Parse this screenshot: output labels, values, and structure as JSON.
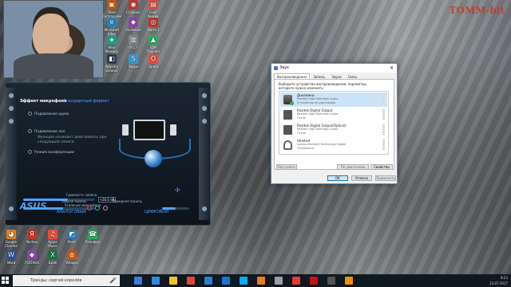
{
  "watermark": "TOMM-bit",
  "desktop_icons": [
    {
      "label": "Total Commander",
      "color": "#d35400",
      "glyph": "▣"
    },
    {
      "label": "CCleaner",
      "color": "#c0392b",
      "glyph": "◉"
    },
    {
      "label": "Foxit Reader",
      "color": "#e74c3c",
      "glyph": "▤"
    },
    {
      "label": "Microsoft Edge",
      "color": "#2980b9",
      "glyph": "e"
    },
    {
      "label": "Uncleaner",
      "color": "#8e44ad",
      "glyph": "◆"
    },
    {
      "label": "Alarm 1",
      "color": "#c0392b",
      "glyph": "◎"
    },
    {
      "label": "Wise Memory",
      "color": "#16a085",
      "glyph": "◈"
    },
    {
      "label": "OCCT",
      "color": "#7f8c8d",
      "glyph": "▥"
    },
    {
      "label": "IDM Thunder",
      "color": "#27ae60",
      "glyph": "▲"
    },
    {
      "label": "Registry Cleaner",
      "color": "#2c3e50",
      "glyph": "◧"
    },
    {
      "label": "Skype",
      "color": "#3498db",
      "glyph": "S"
    },
    {
      "label": "Opera",
      "color": "#e74c3c",
      "glyph": "O"
    }
  ],
  "bottom_icons": [
    {
      "label": "Google Chrome",
      "color": "#e67e22",
      "glyph": "◕"
    },
    {
      "label": "Yandex",
      "color": "#c0392b",
      "glyph": "Я"
    },
    {
      "label": "Apple Music",
      "color": "#e74c3c",
      "glyph": "♫"
    },
    {
      "label": "Paint",
      "color": "#2980b9",
      "glyph": "◩"
    },
    {
      "label": "Телефон",
      "color": "#27ae60",
      "glyph": "☎"
    },
    {
      "label": "Word",
      "color": "#2b5797",
      "glyph": "W"
    },
    {
      "label": "FCKTAGS",
      "color": "#8e44ad",
      "glyph": "◆"
    },
    {
      "label": "Excel",
      "color": "#1e7145",
      "glyph": "X"
    },
    {
      "label": "Villages",
      "color": "#d35400",
      "glyph": "◍"
    }
  ],
  "realtek": {
    "tab_active": "Эффект микрофона",
    "tab_other": "Стандартный формат",
    "options": [
      "Подавление шума",
      "Подавление эха",
      "Режим конференции"
    ],
    "option_hint": "Функция начинает действовать при следующей записи.",
    "volume_label": "Громкость записи",
    "boost_label": "Усиление микрофона",
    "db_value": "+20.0 dB",
    "brand": "ASUS",
    "analog_label": "АНАЛОГОВЫЙ",
    "digital_label": "ЦИФРОВОЙ",
    "back_panel_label": "Задняя панель",
    "front_panel_label": "Передняя панель",
    "volume_level": 0.62,
    "boost_level": 0.55
  },
  "sound_dialog": {
    "title": "Звук",
    "tabs": [
      "Воспроизведение",
      "Запись",
      "Звуки",
      "Связь"
    ],
    "instruction": "Выберите устройство воспроизведения, параметры которого нужно изменить:",
    "devices": [
      {
        "name": "Динамики",
        "sub": "Realtek High Definition Audio",
        "status": "Устройство по умолчанию",
        "icon": "speaker-icon",
        "selected": true,
        "default": true
      },
      {
        "name": "Realtek Digital Output",
        "sub": "Realtek High Definition Audio",
        "status": "Готов",
        "icon": "digital-output-icon",
        "selected": false,
        "default": false
      },
      {
        "name": "Realtek Digital Output(Optical)",
        "sub": "Realtek High Definition Audio",
        "status": "Готов",
        "icon": "optical-output-icon",
        "selected": false,
        "default": false
      },
      {
        "name": "Headset",
        "sub": "Lenovo Headset Technology Digital",
        "status": "Отключено",
        "icon": "headset-icon",
        "selected": false,
        "default": false
      }
    ],
    "configure_btn": "Настроить",
    "default_btn": "По умолчанию",
    "properties_btn": "Свойства",
    "ok_btn": "ОК",
    "cancel_btn": "Отмена",
    "apply_btn": "Применить"
  },
  "taskbar": {
    "search_placeholder": "Тренды: сергей королёв",
    "time": "8:23",
    "date": "13.07.2017",
    "apps": [
      {
        "name": "task-view",
        "color": "#3a7bd5"
      },
      {
        "name": "edge",
        "color": "#2e8bd8"
      },
      {
        "name": "explorer",
        "color": "#f2c12e"
      },
      {
        "name": "chrome",
        "color": "#e0453a"
      },
      {
        "name": "store",
        "color": "#2f7ad1"
      },
      {
        "name": "mail",
        "color": "#1976d2"
      },
      {
        "name": "skype",
        "color": "#00aff0"
      },
      {
        "name": "media",
        "color": "#e67e22"
      },
      {
        "name": "settings",
        "color": "#9e9e9e"
      },
      {
        "name": "yandex",
        "color": "#e53935"
      },
      {
        "name": "opera",
        "color": "#cc0f16"
      },
      {
        "name": "obs",
        "color": "#555555"
      },
      {
        "name": "realtek",
        "color": "#ef8f0b"
      }
    ]
  }
}
